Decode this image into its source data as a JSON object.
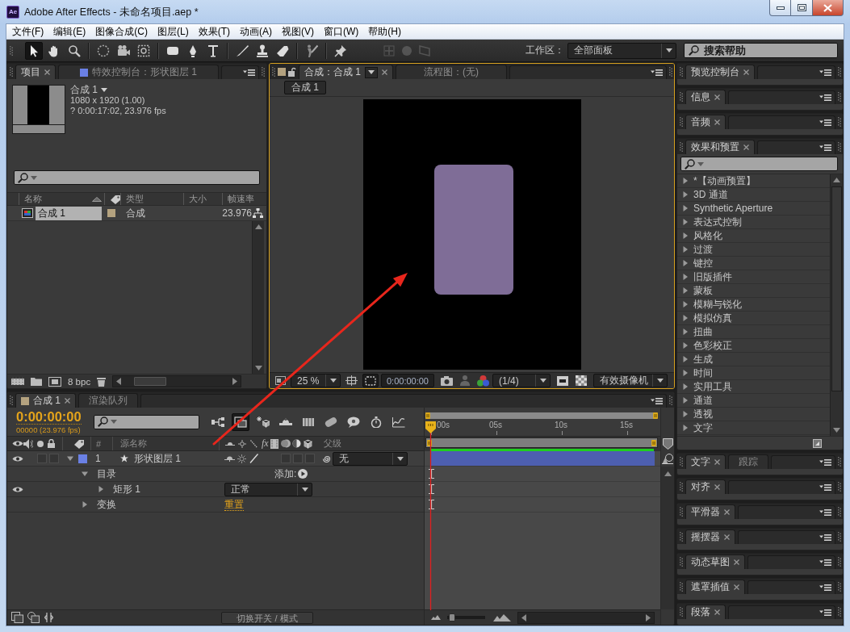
{
  "window": {
    "logo": "Ae",
    "title": "Adobe After Effects - 未命名项目.aep *"
  },
  "menu": [
    "文件(F)",
    "编辑(E)",
    "图像合成(C)",
    "图层(L)",
    "效果(T)",
    "动画(A)",
    "视图(V)",
    "窗口(W)",
    "帮助(H)"
  ],
  "toolbar": {
    "tools": [
      {
        "selected": true
      },
      {
        "selected": false
      },
      {
        "selected": false
      },
      {
        "selected": false
      },
      {
        "selected": false
      },
      {
        "selected": false
      },
      {
        "selected": false
      },
      {
        "selected": false
      },
      {
        "selected": false
      },
      {
        "selected": false
      },
      {
        "selected": false
      },
      {
        "selected": false
      },
      {
        "selected": false
      },
      {
        "selected": false
      }
    ],
    "axis_modes": [
      {
        "disabled": true
      },
      {
        "disabled": true
      },
      {
        "disabled": true
      }
    ],
    "workspace_label": "工作区：",
    "workspace": "全部面板",
    "help_search": {
      "placeholder": "搜索帮助"
    }
  },
  "project_panel": {
    "tabs": [
      {
        "label": "项目",
        "selected": true
      },
      {
        "label": "特效控制台：形状图层 1",
        "selected": false,
        "color": "#6a80e4"
      }
    ],
    "item": {
      "name": "合成 1",
      "dimensions": "1080 x 1920 (1.00)",
      "duration": "? 0:00:17:02, 23.976 fps"
    },
    "columns": [
      "名称",
      "类型",
      "大小",
      "帧速率"
    ],
    "rows": [
      {
        "name": "合成 1",
        "type": "合成",
        "frame_rate": "23.976",
        "color": "#b4a27f",
        "selected": true
      }
    ],
    "bit_depth": "8 bpc"
  },
  "comp_panel": {
    "color": "#b4a27f",
    "tabs": [
      {
        "label": "合成：合成 1",
        "selected": true
      },
      {
        "label": "流程图：(无)",
        "selected": false
      }
    ],
    "breadcrumb": "合成 1",
    "zoom": "25 %",
    "timecode": "0:00:00:00",
    "resolution": "(1/4)",
    "camera": "有效摄像机"
  },
  "timeline": {
    "tabs": [
      {
        "label": "合成 1",
        "selected": true,
        "color": "#b4a27f"
      },
      {
        "label": "渲染队列",
        "selected": false
      }
    ],
    "timecode": "0:00:00:00",
    "frame_info": "00000 (23.976 fps)",
    "switches": [
      {
        "on": false
      },
      {
        "on": true
      },
      {
        "on": false
      },
      {
        "on": false
      },
      {
        "on": false
      },
      {
        "on": false
      },
      {
        "on": false
      },
      {
        "on": false
      },
      {
        "on": false
      }
    ],
    "columns": [
      "#",
      "源名称",
      "父级"
    ],
    "effect_switch": "fx",
    "ruler": [
      "00s",
      "05s",
      "10s",
      "15s"
    ],
    "layers": [
      {
        "index": "1",
        "name": "形状图层 1",
        "color": "#6a80e4",
        "visible": true,
        "solo": false,
        "locked": false,
        "expanded": true,
        "switches": [
          {
            "on": false
          },
          {
            "on": false
          },
          {
            "on": false
          }
        ],
        "parent": "无",
        "children": [
          {
            "label": "目录",
            "expanded": true,
            "action": "添加:",
            "children": [
              {
                "label": "矩形 1",
                "expanded": false,
                "visible": true,
                "mode": "正常"
              }
            ]
          },
          {
            "label": "变换",
            "expanded": false,
            "link": "重置"
          }
        ]
      }
    ],
    "zoom_slider": {
      "level": 0.05
    },
    "mode_toggle": "切换开关 / 模式"
  },
  "right_panels": [
    {
      "kind": "panel",
      "tabs": [
        {
          "label": "预览控制台",
          "selected": true
        }
      ]
    },
    {
      "kind": "panel",
      "tabs": [
        {
          "label": "信息",
          "selected": true
        }
      ]
    },
    {
      "kind": "panel",
      "tabs": [
        {
          "label": "音频",
          "selected": true
        }
      ]
    },
    {
      "kind": "effects",
      "tabs": [
        {
          "label": "效果和预置",
          "selected": true
        }
      ],
      "categories": [
        {
          "label": "*【动画预置】",
          "expanded": false
        },
        {
          "label": "3D 通道",
          "expanded": false
        },
        {
          "label": "Synthetic Aperture",
          "expanded": false
        },
        {
          "label": "表达式控制",
          "expanded": false
        },
        {
          "label": "风格化",
          "expanded": false
        },
        {
          "label": "过渡",
          "expanded": false
        },
        {
          "label": "键控",
          "expanded": false
        },
        {
          "label": "旧版插件",
          "expanded": false
        },
        {
          "label": "蒙板",
          "expanded": false
        },
        {
          "label": "模糊与锐化",
          "expanded": false
        },
        {
          "label": "模拟仿真",
          "expanded": false
        },
        {
          "label": "扭曲",
          "expanded": false
        },
        {
          "label": "色彩校正",
          "expanded": false
        },
        {
          "label": "生成",
          "expanded": false
        },
        {
          "label": "时间",
          "expanded": false
        },
        {
          "label": "实用工具",
          "expanded": false
        },
        {
          "label": "通道",
          "expanded": false
        },
        {
          "label": "透视",
          "expanded": false
        },
        {
          "label": "文字",
          "expanded": false
        }
      ]
    },
    {
      "kind": "panel",
      "tabs": [
        {
          "label": "文字",
          "selected": true
        },
        {
          "label": "跟踪",
          "selected": false
        }
      ]
    },
    {
      "kind": "panel",
      "tabs": [
        {
          "label": "对齐",
          "selected": true
        }
      ]
    },
    {
      "kind": "panel",
      "tabs": [
        {
          "label": "平滑器",
          "selected": true
        }
      ]
    },
    {
      "kind": "panel",
      "tabs": [
        {
          "label": "摇摆器",
          "selected": true
        }
      ]
    },
    {
      "kind": "panel",
      "tabs": [
        {
          "label": "动态草图",
          "selected": true
        }
      ]
    },
    {
      "kind": "panel",
      "tabs": [
        {
          "label": "遮罩插值",
          "selected": true
        }
      ]
    },
    {
      "kind": "panel",
      "tabs": [
        {
          "label": "段落",
          "selected": true
        }
      ]
    }
  ]
}
